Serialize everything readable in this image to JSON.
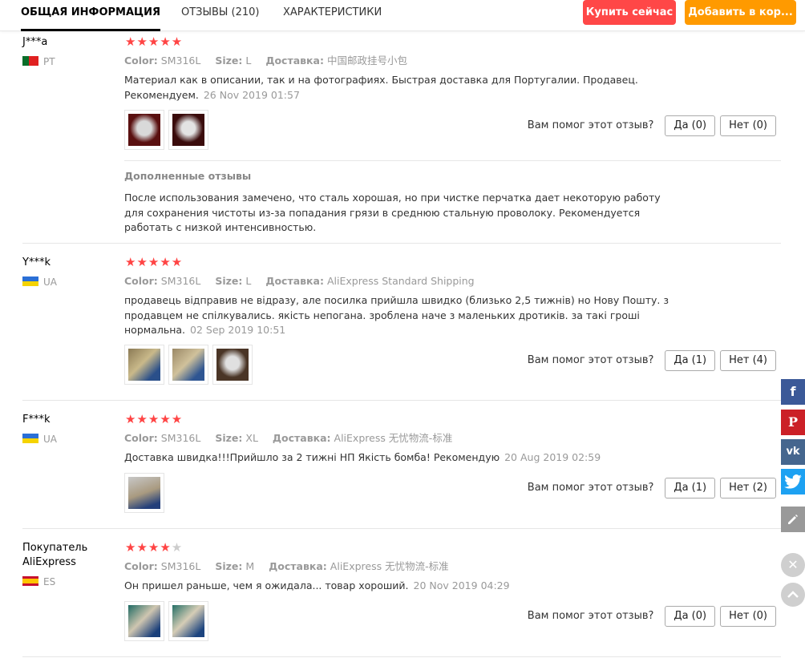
{
  "tabs": [
    "ОБЩАЯ ИНФОРМАЦИЯ",
    "ОТЗЫВЫ (210)",
    "ХАРАКТЕРИСТИКИ"
  ],
  "buttons": {
    "buy_now": "Купить сейчас",
    "add_to_cart": "Добавить в кор..."
  },
  "labels": {
    "color": "Color:",
    "size": "Size:",
    "shipping": "Доставка:",
    "helpful_q": "Вам помог этот отзыв?",
    "extra_reviews": "Дополненные отзывы"
  },
  "reviews": [
    {
      "name": "J***a",
      "country": "PT",
      "stars": 5,
      "color": "SM316L",
      "size": "L",
      "shipping": "中国邮政挂号小包",
      "text": "Материал как в описании, так и на фотографиях. Быстрая доставка для Португалии. Продавец. Рекомендуем.",
      "date": "26 Nov 2019 01:57",
      "yes": "Да (0)",
      "no": "Нет (0)",
      "extra": "После использования замечено, что сталь хорошая, но при чистке перчатка дает некоторую работу для сохранения чистоты из-за попадания грязи в среднюю стальную проволоку. Рекомендуется работать с низкой интенсивностью."
    },
    {
      "name": "Y***k",
      "country": "UA",
      "stars": 5,
      "color": "SM316L",
      "size": "L",
      "shipping": "AliExpress Standard Shipping",
      "text": "продавець відправив не відразу, але посилка прийшла швидко (близько 2,5 тижнів) но Нову Пошту. з продавцем не спілкувались. якість непогана. зроблена наче з маленьких дротиків. за такі гроші нормальна.",
      "date": "02 Sep 2019 10:51",
      "yes": "Да (1)",
      "no": "Нет (4)"
    },
    {
      "name": "F***k",
      "country": "UA",
      "stars": 5,
      "color": "SM316L",
      "size": "XL",
      "shipping": "AliExpress 无忧物流-标准",
      "text": "Доставка швидка!!!Прийшло за 2 тижні НП Якість бомба! Рекомендую",
      "date": "20 Aug 2019 02:59",
      "yes": "Да (1)",
      "no": "Нет (2)"
    },
    {
      "name": "Покупатель AliExpress",
      "country": "ES",
      "stars": 4,
      "color": "SM316L",
      "size": "M",
      "shipping": "AliExpress 无忧物流-标准",
      "text": "Он пришел раньше, чем я ожидала... товар хороший.",
      "date": "20 Nov 2019 04:29",
      "yes": "Да (0)",
      "no": "Нет (0)"
    }
  ],
  "social": [
    "f",
    "P",
    "vk",
    "twitter-icon",
    "pencil-icon",
    "close-icon",
    "chevron-up-icon"
  ]
}
